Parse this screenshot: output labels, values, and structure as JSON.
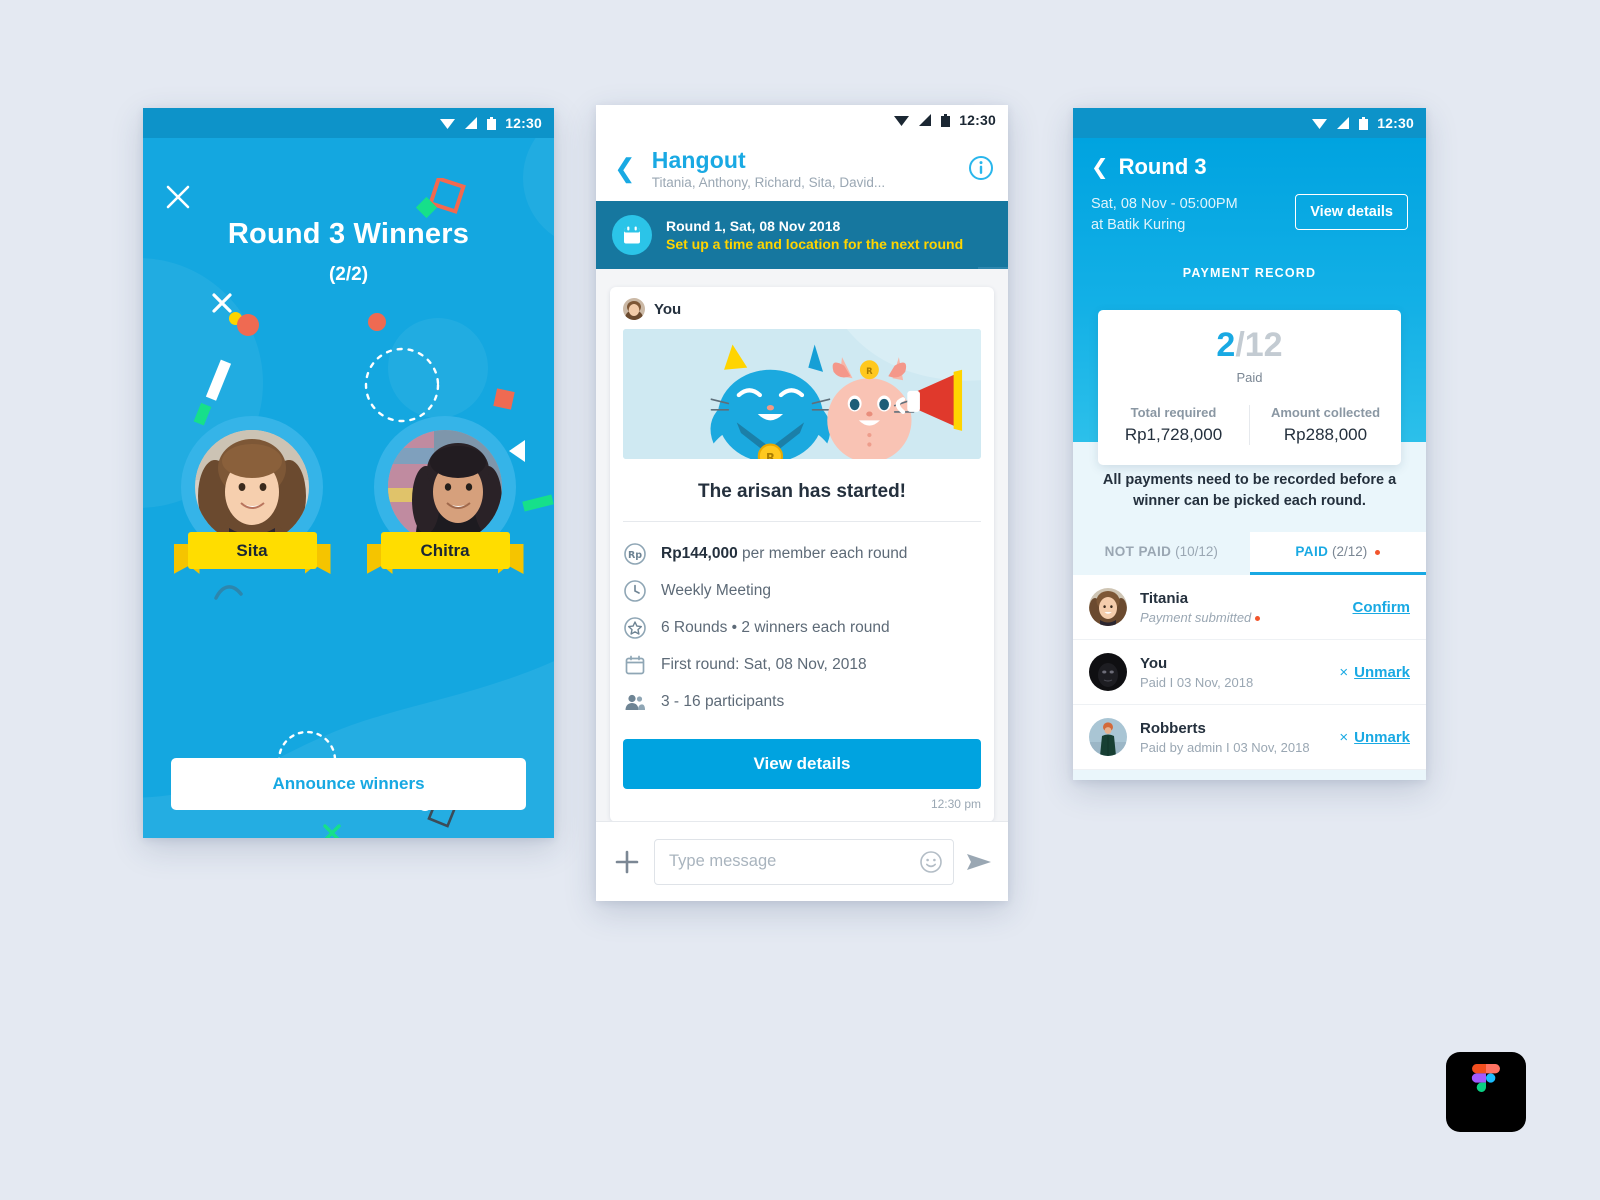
{
  "background_color": "#e4e9f2",
  "accent": "#19a9e3",
  "screen1": {
    "name": "winners-announcement",
    "statusbar": {
      "time": "12:30",
      "icons": [
        "wifi-icon",
        "signal-icon",
        "battery-icon"
      ]
    },
    "close_icon": "close-icon",
    "title": "Round 3 Winners",
    "subtitle": "(2/2)",
    "winners": [
      {
        "name": "Sita"
      },
      {
        "name": "Chitra"
      }
    ],
    "cta_label": "Announce winners"
  },
  "screen2": {
    "name": "hangout-chat",
    "statusbar": {
      "time": "12:30",
      "icons": [
        "wifi-icon",
        "signal-icon",
        "battery-icon"
      ]
    },
    "back_icon": "chevron-left-icon",
    "title": "Hangout",
    "members": "Titania, Anthony, Richard, Sita, David...",
    "info_icon": "info-icon",
    "banner": {
      "icon": "calendar-icon",
      "line1": "Round 1, Sat, 08 Nov 2018",
      "line2": "Set up a time and location for the next round",
      "collapse_icon": "chevron-up-icon"
    },
    "message": {
      "author": "You",
      "illustration": "two-cats-megaphone-illustration",
      "headline": "The arisan has started!",
      "facts": [
        {
          "icon": "rupiah-icon",
          "bold": "Rp144,000",
          "text": " per member each round"
        },
        {
          "icon": "clock-icon",
          "bold": "",
          "text": "Weekly Meeting"
        },
        {
          "icon": "star-badge-icon",
          "bold": "",
          "text": "6 Rounds  •  2 winners each round"
        },
        {
          "icon": "calendar-icon",
          "bold": "",
          "text": "First round: Sat, 08 Nov, 2018"
        },
        {
          "icon": "people-icon",
          "bold": "",
          "text": "3 - 16 participants"
        }
      ],
      "button_label": "View details",
      "timestamp": "12:30 pm"
    },
    "composer": {
      "plus_icon": "plus-icon",
      "placeholder": "Type message",
      "value": "",
      "emoji_icon": "smiley-icon",
      "send_icon": "send-icon"
    }
  },
  "screen3": {
    "name": "round-payment-record",
    "statusbar": {
      "time": "12:30",
      "icons": [
        "wifi-icon",
        "signal-icon",
        "battery-icon"
      ]
    },
    "back_icon": "chevron-left-icon",
    "title": "Round 3",
    "when": "Sat, 08 Nov - 05:00PM",
    "where": "at Batik Kuring",
    "view_details_label": "View details",
    "record_label": "PAYMENT RECORD",
    "paid_count": "2",
    "paid_total": "/12",
    "paid_label": "Paid",
    "totals": [
      {
        "key": "Total required",
        "value": "Rp1,728,000"
      },
      {
        "key": "Amount collected",
        "value": "Rp288,000"
      }
    ],
    "note": "All payments need to be recorded before a winner can be picked each round.",
    "tabs": [
      {
        "key": "NOT PAID",
        "count": "(10/12)",
        "active": false,
        "badge": false
      },
      {
        "key": "PAID",
        "count": "(2/12)",
        "active": true,
        "badge": true
      }
    ],
    "rows": [
      {
        "avatar": "avatar-titania",
        "name": "Titania",
        "sub": "Payment submitted",
        "italic": true,
        "badge": true,
        "action": "Confirm",
        "has_x": false
      },
      {
        "avatar": "avatar-you",
        "name": "You",
        "sub": "Paid  I  03 Nov, 2018",
        "italic": false,
        "badge": false,
        "action": "Unmark",
        "has_x": true
      },
      {
        "avatar": "avatar-robberts",
        "name": "Robberts",
        "sub": "Paid by admin  I  03 Nov, 2018",
        "italic": false,
        "badge": false,
        "action": "Unmark",
        "has_x": true
      }
    ]
  },
  "watermark": {
    "icon": "figma-logo-icon"
  }
}
